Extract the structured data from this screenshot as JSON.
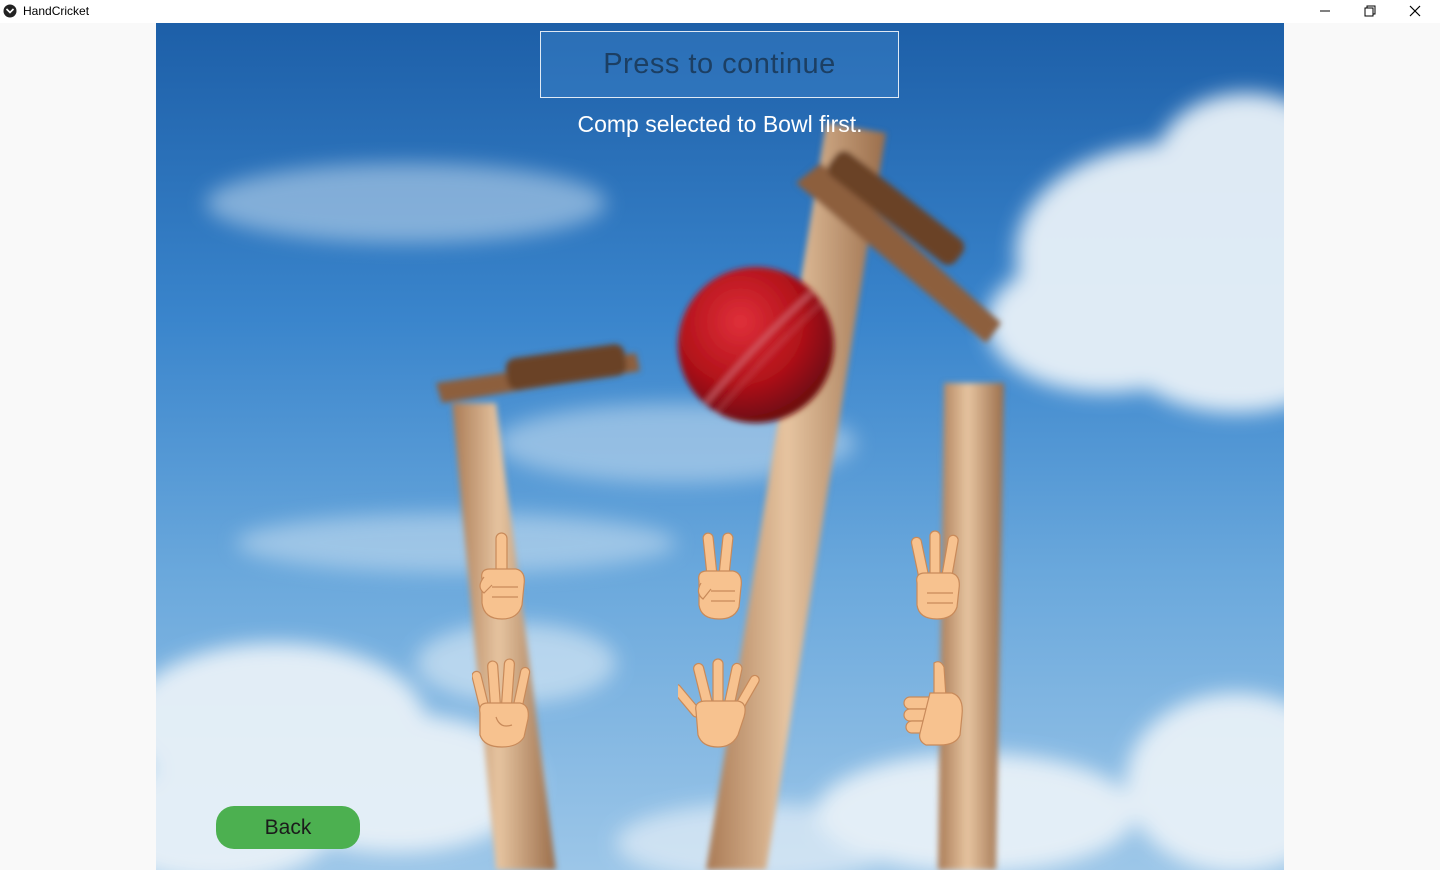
{
  "window": {
    "title": "HandCricket",
    "icon": "app-icon",
    "controls": [
      "minimize-icon",
      "restore-icon",
      "close-icon"
    ]
  },
  "game": {
    "continue_label": "Press to continue",
    "status_message": "Comp selected to Bowl first.",
    "hands": [
      {
        "name": "hand-one-icon",
        "value": "1"
      },
      {
        "name": "hand-two-icon",
        "value": "2"
      },
      {
        "name": "hand-three-icon",
        "value": "3"
      },
      {
        "name": "hand-four-icon",
        "value": "4"
      },
      {
        "name": "hand-five-icon",
        "value": "5"
      },
      {
        "name": "hand-six-icon",
        "value": "6"
      }
    ],
    "back_label": "Back"
  },
  "colors": {
    "back_button": "#4cb050",
    "sky": "#3a85cc",
    "ball": "#c0141a",
    "stump": "#c9a07a",
    "skin": "#f7c28f"
  }
}
